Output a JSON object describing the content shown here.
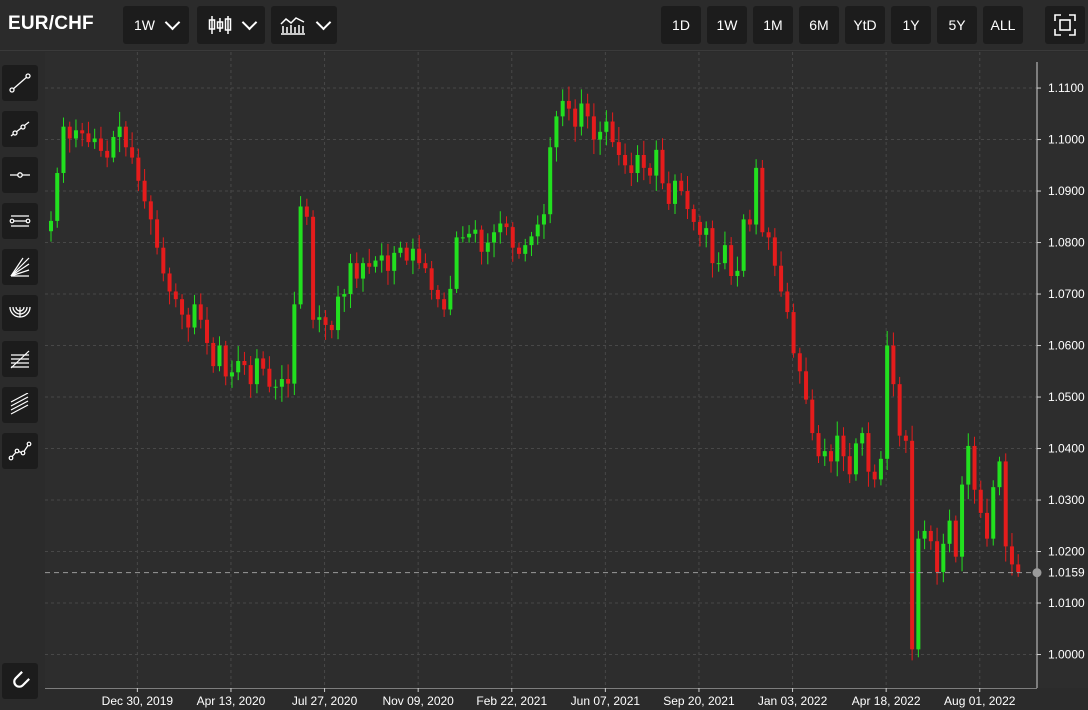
{
  "header": {
    "symbol": "EUR/CHF",
    "interval_label": "1W",
    "chart_type_icon": "candlestick-icon",
    "indicator_icon": "indicators-icon",
    "ranges": [
      "1D",
      "1W",
      "1M",
      "6M",
      "YtD",
      "1Y",
      "5Y",
      "ALL"
    ],
    "fullscreen_icon": "fullscreen-icon"
  },
  "sidebar": {
    "tools": [
      "trend-line-icon",
      "ray-icon",
      "horizontal-line-icon",
      "parallel-channel-icon",
      "fan-icon",
      "arc-icon",
      "fib-retracement-icon",
      "fib-extension-icon",
      "path-icon"
    ],
    "magnet_icon": "magnet-icon"
  },
  "chart_data": {
    "type": "candlestick",
    "symbol": "EUR/CHF",
    "interval": "1W",
    "y_ticks": [
      "1.1100",
      "1.1000",
      "1.0900",
      "1.0800",
      "1.0700",
      "1.0600",
      "1.0500",
      "1.0400",
      "1.0300",
      "1.0200",
      "1.0100",
      "1.0000"
    ],
    "x_ticks": [
      "Dec 30, 2019",
      "Apr 13, 2020",
      "Jul 27, 2020",
      "Nov 09, 2020",
      "Feb 22, 2021",
      "Jun 07, 2021",
      "Sep 20, 2021",
      "Jan 03, 2022",
      "Apr 18, 2022",
      "Aug 01, 2022"
    ],
    "ylim": [
      0.9935,
      1.117
    ],
    "last_price": "1.0159",
    "last_price_value": 1.0159,
    "colors": {
      "up": "#22e01f",
      "down": "#e51c1c",
      "background": "#2d2d2d",
      "grid": "#484848",
      "last_line": "#9a9a9a"
    },
    "grid": true,
    "closes": [
      1.0842,
      1.0935,
      1.1025,
      1.1002,
      1.1018,
      1.1012,
      1.0995,
      1.1002,
      1.0978,
      1.0965,
      1.1005,
      1.1025,
      1.0985,
      1.0965,
      1.092,
      1.088,
      1.0845,
      1.079,
      1.074,
      1.0705,
      1.069,
      1.066,
      1.0635,
      1.068,
      1.065,
      1.0605,
      1.056,
      1.06,
      1.054,
      1.0548,
      1.057,
      1.0562,
      1.0525,
      1.0575,
      1.0555,
      1.052,
      1.052,
      1.0535,
      1.0526,
      1.068,
      1.087,
      1.085,
      1.065,
      1.0655,
      1.064,
      1.063,
      1.0695,
      1.07,
      1.076,
      1.073,
      1.076,
      1.0753,
      1.0765,
      1.0775,
      1.0745,
      1.078,
      1.079,
      1.0765,
      1.0788,
      1.076,
      1.075,
      1.0708,
      1.069,
      1.067,
      1.071,
      1.081,
      1.081,
      1.0817,
      1.0825,
      1.0782,
      1.08,
      1.082,
      1.0837,
      1.083,
      1.079,
      1.0778,
      1.0795,
      1.0812,
      1.0835,
      1.0855,
      1.0985,
      1.1045,
      1.1075,
      1.106,
      1.1025,
      1.107,
      1.1045,
      1.1,
      1.1015,
      1.1035,
      1.0995,
      1.097,
      1.095,
      1.0935,
      1.097,
      1.0945,
      1.093,
      1.098,
      1.0915,
      1.0875,
      1.092,
      1.09,
      1.0865,
      1.084,
      1.0815,
      1.0828,
      1.076,
      1.076,
      1.0795,
      1.0735,
      1.0745,
      1.0845,
      1.0835,
      1.0945,
      1.082,
      1.081,
      1.0755,
      1.0705,
      1.0665,
      1.0585,
      1.055,
      1.0495,
      1.043,
      1.0385,
      1.0395,
      1.0375,
      1.0425,
      1.0385,
      1.035,
      1.041,
      1.043,
      1.0355,
      1.034,
      1.038,
      1.06,
      1.0525,
      1.0425,
      1.0415,
      1.001,
      1.0225,
      1.024,
      1.022,
      1.016,
      1.0215,
      1.026,
      1.019,
      1.033,
      1.0405,
      1.032,
      1.0275,
      1.0225,
      1.0325,
      1.0375,
      1.021,
      1.0175,
      1.016
    ]
  }
}
